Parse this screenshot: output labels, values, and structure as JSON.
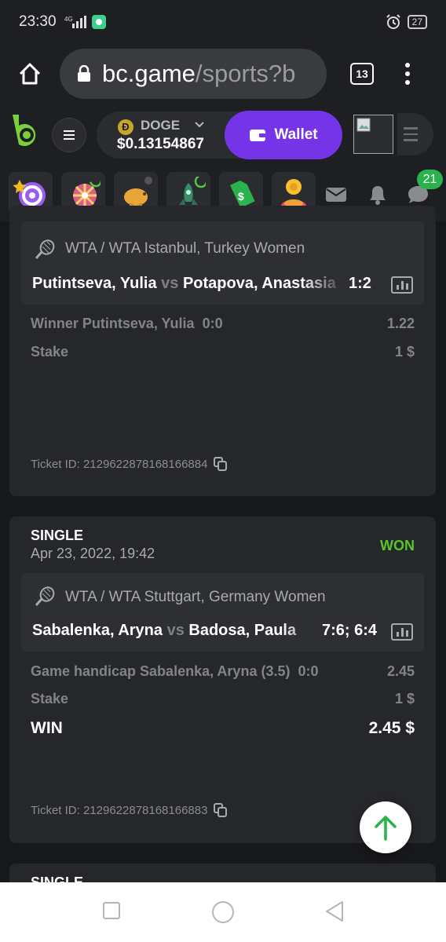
{
  "status_bar": {
    "time": "23:30",
    "network": "4G",
    "battery": "27"
  },
  "browser": {
    "url_host": "bc.game",
    "url_path": "/sports?b",
    "tabs_count": "13"
  },
  "header": {
    "coin_symbol": "Ð",
    "coin_name": "DOGE",
    "balance": "$0.13154867",
    "wallet_label": "Wallet"
  },
  "quick_bar": {
    "badge_count": "21"
  },
  "bets": [
    {
      "league": "WTA / WTA Istanbul, Turkey Women",
      "home": "Putintseva, Yulia",
      "vs": "vs",
      "away": "Potapova, Anastasia",
      "score": "1:2",
      "market": "Winner Putintseva, Yulia",
      "market_score": "0:0",
      "odds": "1.22",
      "stake_label": "Stake",
      "stake": "1 $",
      "ticket_label": "Ticket ID: 2129622878168166884"
    },
    {
      "type": "SINGLE",
      "date": "Apr 23, 2022, 19:42",
      "status": "WON",
      "league": "WTA / WTA Stuttgart, Germany Women",
      "home": "Sabalenka, Aryna",
      "vs": "vs",
      "away": "Badosa, Paula",
      "score": "7:6; 6:4",
      "market": "Game handicap Sabalenka, Aryna (3.5)",
      "market_score": "0:0",
      "odds": "2.45",
      "stake_label": "Stake",
      "stake": "1 $",
      "win_label": "WIN",
      "win_amount": "2.45 $",
      "ticket_label": "Ticket ID: 2129622878168166883"
    },
    {
      "type": "SINGLE"
    }
  ],
  "icons": [
    "home-icon",
    "lock-icon",
    "tabs-icon",
    "more-icon",
    "menu-icon",
    "chevron-down-icon",
    "wallet-icon",
    "spin-icon",
    "wheel-icon",
    "piggy-icon",
    "rocket-icon",
    "tag-icon",
    "coin-icon",
    "mail-icon",
    "bell-icon",
    "chat-icon",
    "tennis-icon",
    "stats-icon",
    "copy-icon",
    "arrow-up-icon"
  ]
}
